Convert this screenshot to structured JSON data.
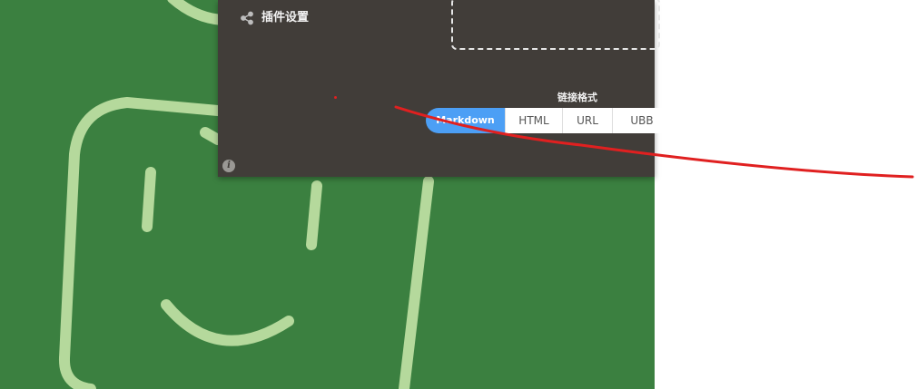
{
  "plugin_settings": {
    "label": "插件设置",
    "icon": "share-icon"
  },
  "link_format": {
    "title": "链接格式",
    "options": [
      "Markdown",
      "HTML",
      "URL",
      "UBB"
    ],
    "selected": "Markdown"
  },
  "info": {
    "glyph": "i",
    "icon": "info-icon"
  },
  "colors": {
    "background_green": "#3b8040",
    "doodle_green": "#b5d99c",
    "panel": "#413d39",
    "accent_blue": "#4c9ff5",
    "annotation_red": "#e02020"
  }
}
